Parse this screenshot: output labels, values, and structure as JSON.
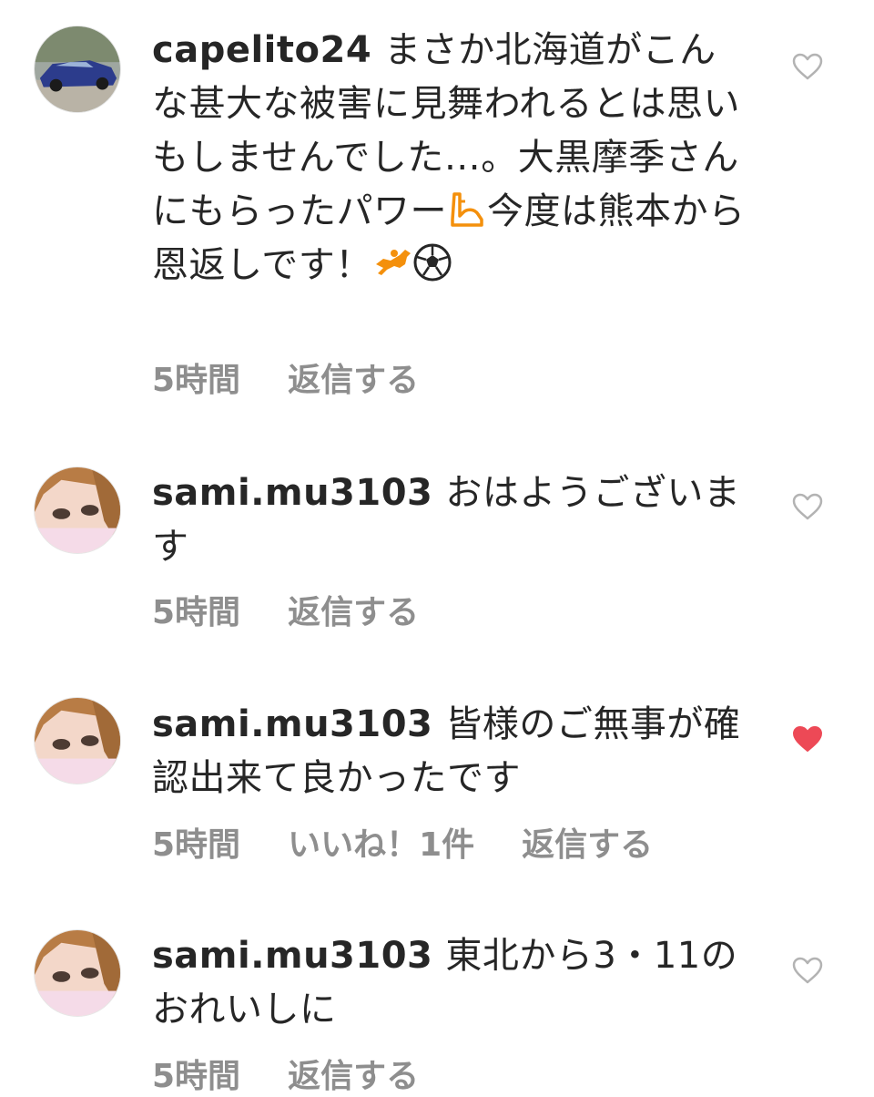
{
  "comments": [
    {
      "username": "capelito24",
      "text_a": "まさか北海道がこんな甚大な被害に見舞われるとは思いもしませんでした…。大黒摩季さんにもらったパワー",
      "text_b": "今度は熊本から恩返しです！",
      "emojis": [
        "flexed-biceps-icon",
        "horse-racing-icon",
        "soccer-ball-icon"
      ],
      "time": "5時間",
      "reply": "返信する",
      "liked": false
    },
    {
      "username": "sami.mu3103",
      "text": "おはようございます",
      "time": "5時間",
      "reply": "返信する",
      "liked": false
    },
    {
      "username": "sami.mu3103",
      "text": "皆様のご無事が確認出来て良かったです",
      "time": "5時間",
      "likes": "いいね！1件",
      "reply": "返信する",
      "liked": true
    },
    {
      "username": "sami.mu3103",
      "text": "東北から3・11のおれいしに",
      "time": "5時間",
      "reply": "返信する",
      "liked": false
    }
  ],
  "colors": {
    "text": "#262626",
    "meta": "#8e8e8e",
    "heart_outline": "#b3b3b3",
    "heart_liked": "#ed4956",
    "emoji_orange": "#f4900c"
  }
}
